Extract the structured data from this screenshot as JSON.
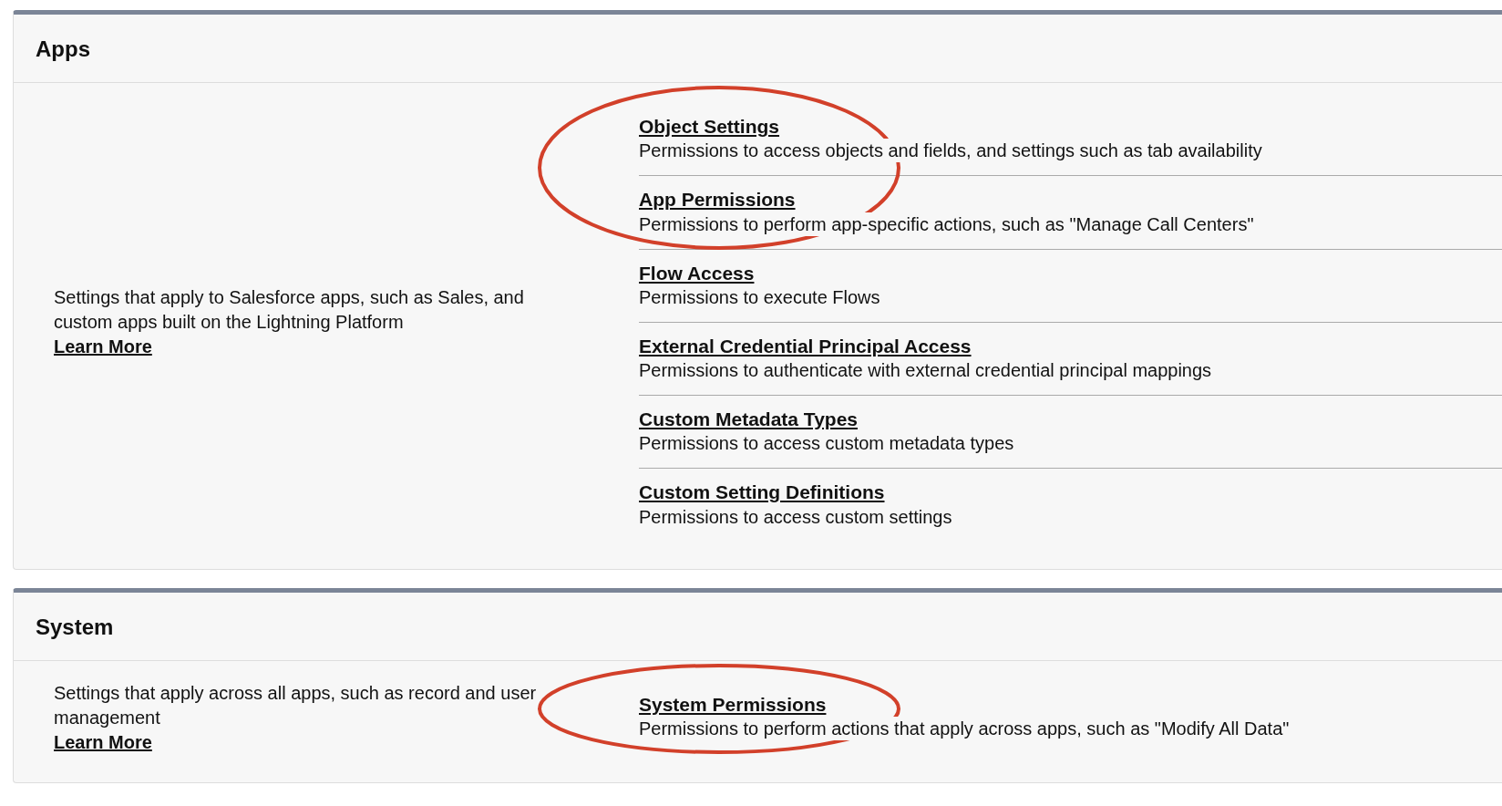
{
  "sections": [
    {
      "title": "Apps",
      "description": "Settings that apply to Salesforce apps, such as Sales, and custom apps built on the Lightning Platform",
      "learn_more": "Learn More",
      "items": [
        {
          "title": "Object Settings",
          "description": "Permissions to access objects and fields, and settings such as tab availability",
          "circled": true
        },
        {
          "title": "App Permissions",
          "description": "Permissions to perform app-specific actions, such as \"Manage Call Centers\"",
          "circled": true
        },
        {
          "title": "Flow Access",
          "description": "Permissions to execute Flows",
          "circled": false
        },
        {
          "title": "External Credential Principal Access",
          "description": "Permissions to authenticate with external credential principal mappings",
          "circled": false
        },
        {
          "title": "Custom Metadata Types",
          "description": "Permissions to access custom metadata types",
          "circled": false
        },
        {
          "title": "Custom Setting Definitions",
          "description": "Permissions to access custom settings",
          "circled": false
        }
      ]
    },
    {
      "title": "System",
      "description": "Settings that apply across all apps, such as record and user management",
      "learn_more": "Learn More",
      "items": [
        {
          "title": "System Permissions",
          "description": "Permissions to perform actions that apply across apps, such as \"Modify All Data\"",
          "circled": true
        }
      ]
    }
  ]
}
